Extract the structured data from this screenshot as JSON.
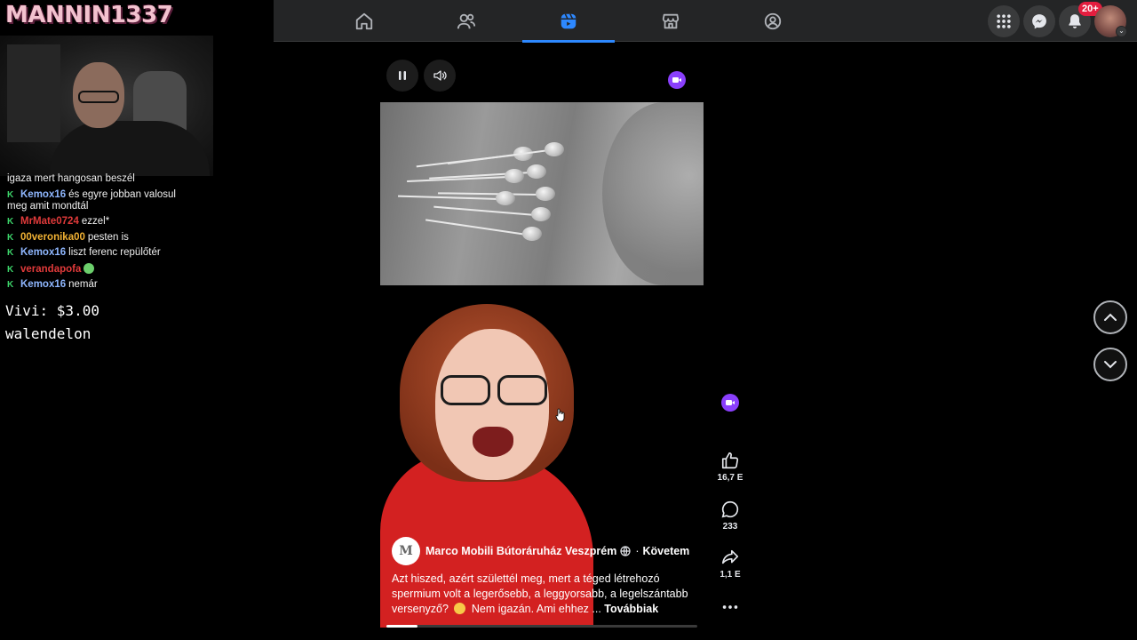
{
  "stream_overlay": {
    "streamer_name": "MANNIN1337",
    "chat": [
      {
        "user": "",
        "message": "igaza mert hangosan beszél",
        "color": "#ffffff",
        "badge": false
      },
      {
        "user": "Kemox16",
        "message": "és egyre jobban valosul meg amit mondtál",
        "color": "#8fb7ff",
        "badge": true
      },
      {
        "user": "MrMate0724",
        "message": "ezzel*",
        "color": "#e03a3a",
        "badge": true
      },
      {
        "user": "00veronika00",
        "message": "pesten is",
        "color": "#f2b234",
        "badge": true
      },
      {
        "user": "Kemox16",
        "message": "liszt ferenc repülőtér",
        "color": "#8fb7ff",
        "badge": true
      },
      {
        "user": "verandapofa",
        "message": "",
        "color": "#e03a3a",
        "badge": true,
        "emote": true
      },
      {
        "user": "Kemox16",
        "message": "nemár",
        "color": "#8fb7ff",
        "badge": true
      }
    ],
    "donation_line1": "Vivi: $3.00",
    "donation_line2": "walendelon"
  },
  "topbar": {
    "tabs": [
      {
        "name": "home",
        "icon": "home-icon",
        "active": false
      },
      {
        "name": "friends",
        "icon": "friends-icon",
        "active": false
      },
      {
        "name": "reels",
        "icon": "reels-icon",
        "active": true
      },
      {
        "name": "marketplace",
        "icon": "marketplace-icon",
        "active": false
      },
      {
        "name": "groups",
        "icon": "groups-icon",
        "active": false
      }
    ],
    "notification_badge": "20+",
    "accent_color": "#2d88ff"
  },
  "reel": {
    "author_initial": "M",
    "author": "Marco Mobili Bútoráruház Veszprém",
    "follow_separator": "·",
    "follow_label": "Követem",
    "caption_part1": "Azt hiszed, azért születtél meg, mert a téged létrehozó spermium volt a legerősebb, a leggyorsabb, a legelszántabb versenyző?",
    "caption_part2": "Nem igazán. Ami ehhez ...",
    "more_label": "Továbbiak",
    "progress": 0.1,
    "likes": "16,7 E",
    "comments": "233",
    "shares": "1,1 E"
  }
}
